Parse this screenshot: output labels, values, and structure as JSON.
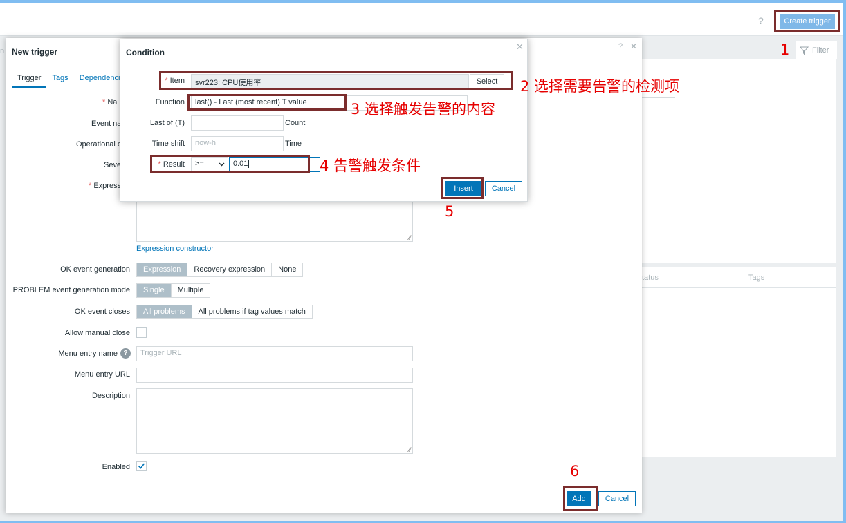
{
  "page": {
    "help_label": "?",
    "create_trigger_label": "Create trigger",
    "filter_label": "Filter",
    "filter_icon": "filter-icon",
    "column_status": "tatus",
    "column_tags": "Tags",
    "left_fragment": "n"
  },
  "trigger_modal": {
    "title": "New trigger",
    "help_label": "?",
    "close_label": "✕",
    "tabs": [
      {
        "label": "Trigger",
        "active": true
      },
      {
        "label": "Tags"
      },
      {
        "label": "Dependencies"
      }
    ],
    "fields": {
      "name_label": "Na",
      "event_name_label": "Event na",
      "operational_label": "Operational c",
      "severity_label": "Seve",
      "expression_label": "Express",
      "expression_constructor_link": "Expression constructor",
      "ok_event_generation_label": "OK event generation",
      "ok_event_generation_options": [
        "Expression",
        "Recovery expression",
        "None"
      ],
      "problem_mode_label": "PROBLEM event generation mode",
      "problem_mode_options": [
        "Single",
        "Multiple"
      ],
      "ok_event_closes_label": "OK event closes",
      "ok_event_closes_options": [
        "All problems",
        "All problems if tag values match"
      ],
      "allow_manual_close_label": "Allow manual close",
      "menu_entry_name_label": "Menu entry name",
      "menu_entry_name_placeholder": "Trigger URL",
      "menu_entry_url_label": "Menu entry URL",
      "description_label": "Description",
      "enabled_label": "Enabled"
    },
    "add_label": "Add",
    "cancel_label": "Cancel"
  },
  "condition_dialog": {
    "title": "Condition",
    "close_label": "✕",
    "item_label": "Item",
    "item_value": "svr223: CPU使用率",
    "select_label": "Select",
    "function_label": "Function",
    "function_value": "last() - Last (most recent) T value",
    "last_of_label": "Last of (T)",
    "count_label": "Count",
    "time_shift_label": "Time shift",
    "time_shift_placeholder": "now-h",
    "time_label": "Time",
    "result_label": "Result",
    "result_operator": ">=",
    "result_value": "0.01",
    "insert_label": "Insert",
    "cancel_label": "Cancel"
  },
  "annotations": {
    "step1": "1",
    "step2": "2 选择需要告警的检测项",
    "step3": "3 选择触发告警的内容",
    "step4": "4 告警触发条件",
    "step5": "5",
    "step6": "6"
  },
  "colors": {
    "accent": "#0275b8",
    "annotation_red": "#e60000",
    "highlight_border": "#7b2d2d",
    "create_button": "#7fb8e8"
  }
}
